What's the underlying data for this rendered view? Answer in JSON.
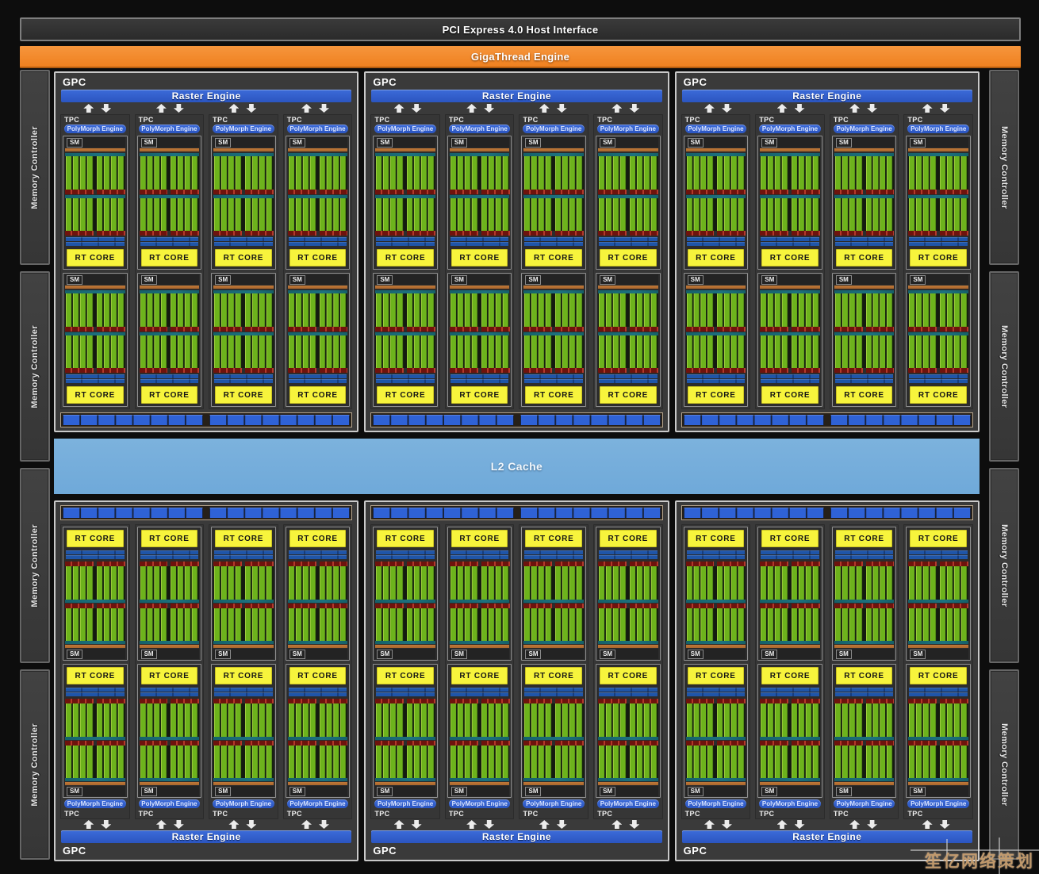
{
  "pci_bar": {
    "label": "PCI Express 4.0 Host Interface"
  },
  "gigathread": {
    "label": "GigaThread Engine"
  },
  "l2_cache": {
    "label": "L2 Cache"
  },
  "memory": {
    "label": "Memory Controller",
    "left_blocks": 4,
    "right_blocks": 4
  },
  "gpc": {
    "label": "GPC",
    "raster_engine_label": "Raster Engine",
    "tpc_label": "TPC",
    "polymorph_engine_label": "PolyMorph Engine",
    "sm_label": "SM",
    "rt_core_label": "RT CORE",
    "top_row_count": 3,
    "bottom_row_count": 3,
    "tpcs_per_gpc": 4,
    "sms_per_tpc": 2,
    "core_rows_per_sm": 2,
    "core_groups_per_row": 2,
    "cores_per_group": 4,
    "texture_segments_per_half": 8
  },
  "watermark": {
    "text": "笙亿网络策划"
  },
  "colors": {
    "background": "#0d0d0d",
    "panel_gray": "#3a3a3a",
    "engine_blue": "#2b55c0",
    "engine_blue_light": "#3c6bd9",
    "gigathread_orange": "#ef8120",
    "gigathread_orange_light": "#f6953c",
    "l2_blue": "#6fa9d9",
    "l2_blue_light": "#7cb2dd",
    "rt_core_yellow": "#f7f43c",
    "core_green": "#6db31c",
    "core_green_light": "#9fcc3e",
    "sm_orange": "#a9662d",
    "sm_orange_light": "#c07a38",
    "teal_strip": "#156069",
    "maroon_strip": "#6e130d",
    "texture_blue": "#2f62d6",
    "texture_navy": "#18233f",
    "watermark_tan": "#c9a071"
  }
}
